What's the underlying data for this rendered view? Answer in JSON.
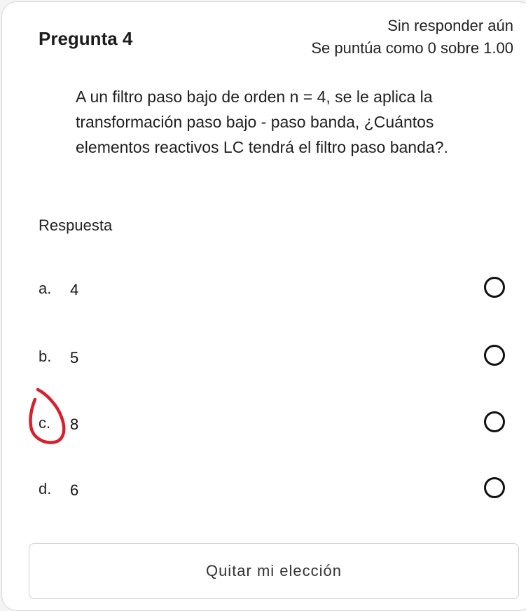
{
  "question": {
    "title": "Pregunta 4",
    "status": "Sin responder aún",
    "grade": "Se puntúa como 0 sobre 1.00",
    "text": "A un filtro paso bajo de orden n = 4, se le aplica la transformación paso bajo - paso banda, ¿Cuántos elementos reactivos LC tendrá el filtro paso banda?."
  },
  "answer": {
    "label": "Respuesta",
    "options": [
      {
        "letter": "a.",
        "text": "4"
      },
      {
        "letter": "b.",
        "text": "5"
      },
      {
        "letter": "c.",
        "text": "8"
      },
      {
        "letter": "d.",
        "text": "6"
      }
    ]
  },
  "actions": {
    "clear_label": "Quitar mi elección"
  },
  "colors": {
    "annotation": "#d81f2a"
  }
}
